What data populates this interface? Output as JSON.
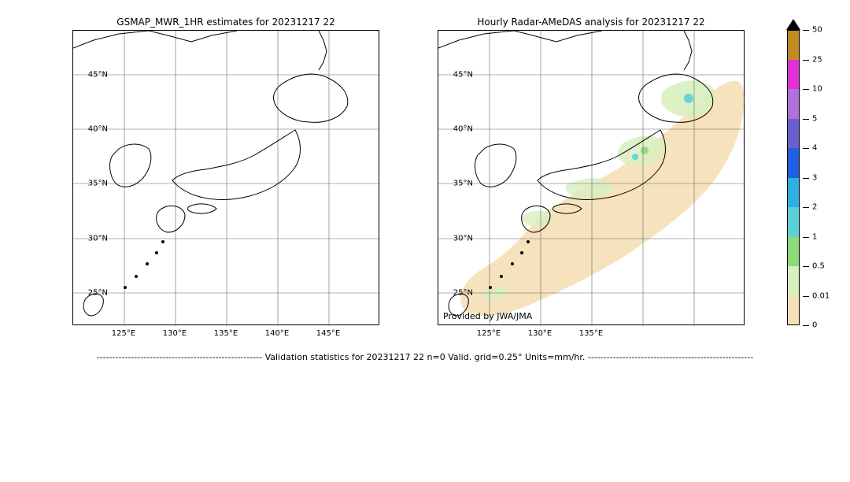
{
  "chart_data": [
    {
      "type": "heatmap",
      "title": "GSMAP_MWR_1HR estimates for 20231217 22",
      "xlabel": "",
      "ylabel": "",
      "x_ticks": [
        "125°E",
        "130°E",
        "135°E",
        "140°E",
        "145°E"
      ],
      "y_ticks": [
        "25°N",
        "30°N",
        "35°N",
        "40°N",
        "45°N"
      ],
      "xlim": [
        120,
        150
      ],
      "ylim": [
        22,
        49
      ],
      "grid": true,
      "series": [],
      "note": "No precipitation rendered in this panel (values below threshold)."
    },
    {
      "type": "heatmap",
      "title": "Hourly Radar-AMeDAS analysis for 20231217 22",
      "xlabel": "",
      "ylabel": "",
      "x_ticks": [
        "125°E",
        "130°E",
        "135°E"
      ],
      "y_ticks": [
        "25°N",
        "30°N",
        "35°N",
        "40°N",
        "45°N"
      ],
      "xlim": [
        120,
        150
      ],
      "ylim": [
        22,
        49
      ],
      "grid": true,
      "attribution": "Provided by JWA/JMA",
      "regions": [
        {
          "name": "coverage-swath",
          "approx_value_range": [
            0,
            0.01
          ],
          "desc": "Broad tan radar-coverage swath over Japan and offshore"
        },
        {
          "name": "light-precip",
          "approx_value_range": [
            0.01,
            0.5
          ],
          "desc": "Pale-green patches along Japan Sea coast, Tōhoku, Hokkaidō, Kyūshū, Ryūkyū"
        },
        {
          "name": "moderate-precip",
          "approx_value_range": [
            0.5,
            2
          ],
          "desc": "Small green/cyan spots over parts of Hokkaidō and northern Honshū"
        }
      ]
    }
  ],
  "colorbar": {
    "orientation": "vertical",
    "extend": "max",
    "levels": [
      0,
      0.01,
      0.5,
      1,
      2,
      3,
      4,
      5,
      10,
      25,
      50
    ],
    "tick_labels": [
      "0",
      "0.01",
      "0.5",
      "1",
      "2",
      "3",
      "4",
      "5",
      "10",
      "25",
      "50"
    ],
    "colors": [
      "#f5dfb6",
      "#d8efc0",
      "#8fd97a",
      "#5bd0d8",
      "#2db0e0",
      "#1f5fe0",
      "#6a5fd0",
      "#b072d8",
      "#e030d8",
      "#c08a20"
    ],
    "units": "mm/hr"
  },
  "footer": {
    "text": "Validation statistics for 20231217 22  n=0 Valid. grid=0.25° Units=mm/hr."
  }
}
